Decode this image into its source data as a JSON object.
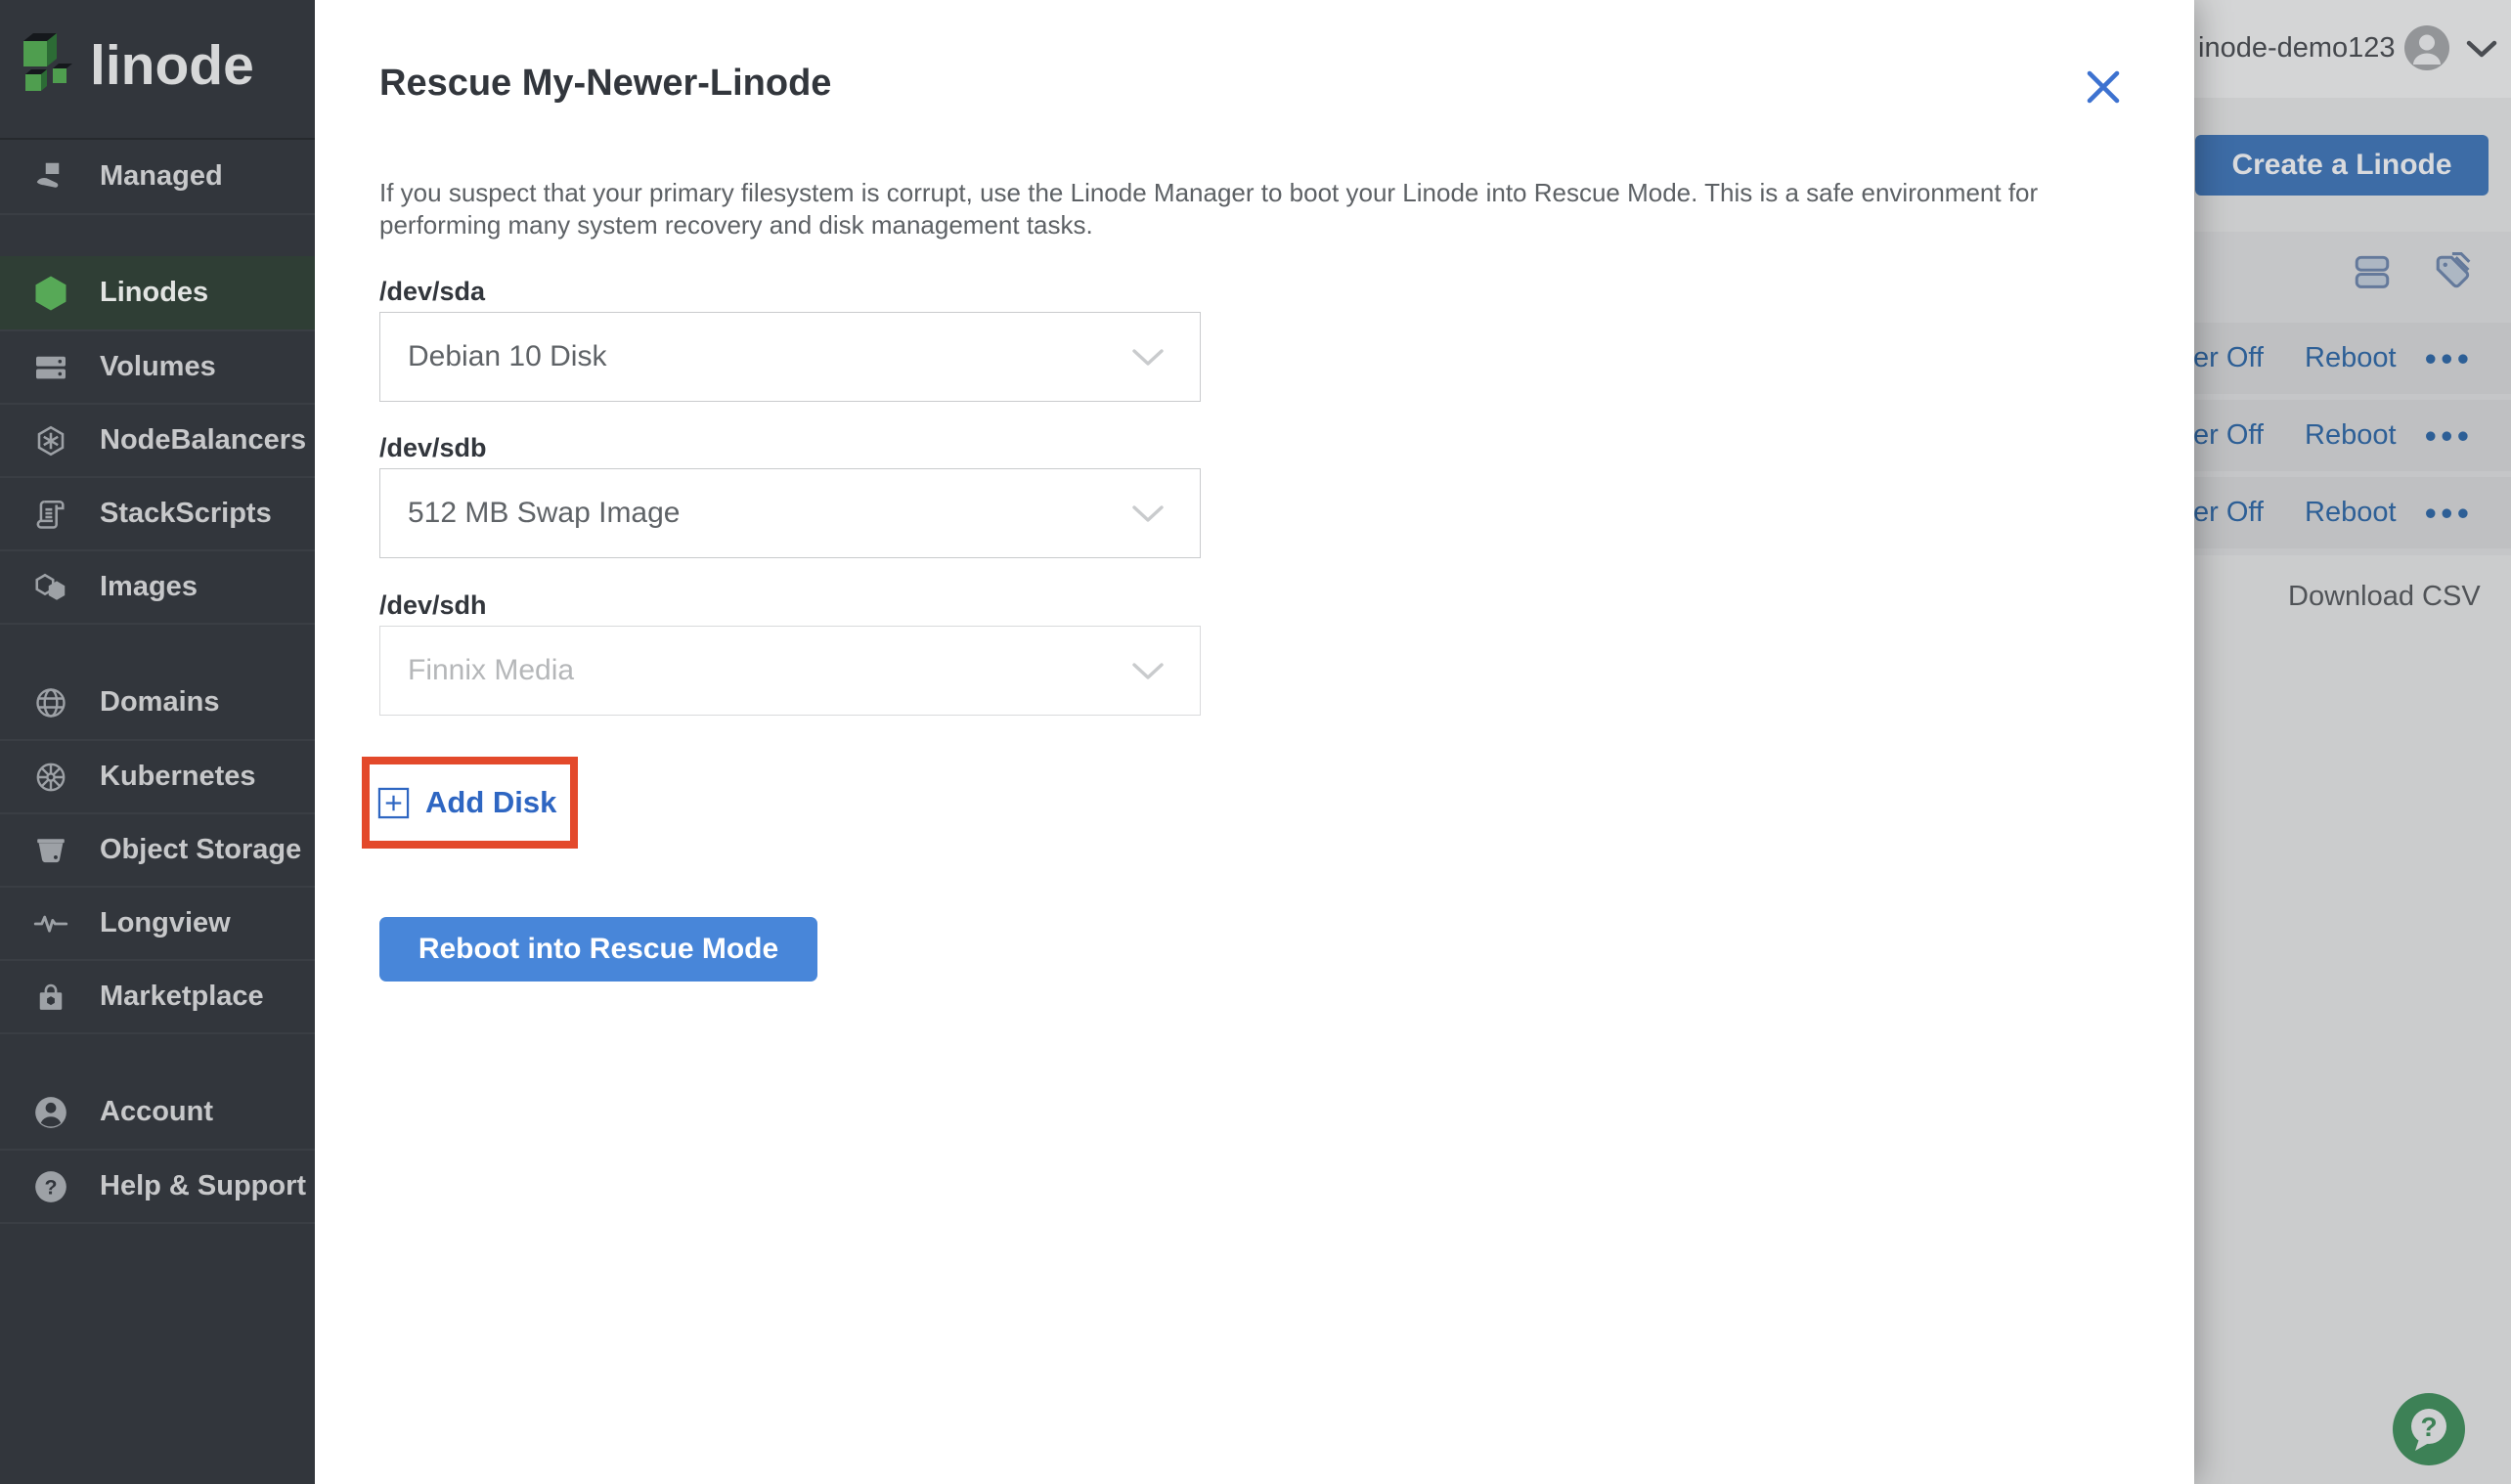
{
  "sidebar": {
    "logo_text": "linode",
    "groups": [
      {
        "items": [
          {
            "label": "Managed"
          }
        ]
      },
      {
        "items": [
          {
            "label": "Linodes",
            "selected": true
          },
          {
            "label": "Volumes"
          },
          {
            "label": "NodeBalancers"
          },
          {
            "label": "StackScripts"
          },
          {
            "label": "Images"
          }
        ]
      },
      {
        "items": [
          {
            "label": "Domains"
          },
          {
            "label": "Kubernetes"
          },
          {
            "label": "Object Storage"
          },
          {
            "label": "Longview"
          },
          {
            "label": "Marketplace"
          }
        ]
      },
      {
        "items": [
          {
            "label": "Account"
          },
          {
            "label": "Help & Support"
          }
        ]
      }
    ]
  },
  "drawer": {
    "title": "Rescue My-Newer-Linode",
    "description": "If you suspect that your primary filesystem is corrupt, use the Linode Manager to boot your Linode into Rescue Mode. This is a safe environment for performing many system recovery and disk management tasks.",
    "fields": [
      {
        "label": "/dev/sda",
        "value": "Debian 10 Disk",
        "disabled": false
      },
      {
        "label": "/dev/sdb",
        "value": "512 MB Swap Image",
        "disabled": false
      },
      {
        "label": "/dev/sdh",
        "value": "Finnix Media",
        "disabled": true
      }
    ],
    "add_disk_label": "Add Disk",
    "submit_label": "Reboot into Rescue Mode"
  },
  "topbar": {
    "username": "inode-demo123"
  },
  "background_page": {
    "create_button_label": "Create a Linode",
    "table_rows": [
      {
        "power_label": "er Off",
        "reboot_label": "Reboot",
        "more_label": "•••"
      },
      {
        "power_label": "er Off",
        "reboot_label": "Reboot",
        "more_label": "•••"
      },
      {
        "power_label": "er Off",
        "reboot_label": "Reboot",
        "more_label": "•••"
      }
    ],
    "download_csv_label": "Download CSV"
  },
  "colors": {
    "accent_blue": "#3683dc",
    "submit_blue": "#4886d9",
    "annotation_red": "#e3492b",
    "sidebar_bg": "#32363c",
    "sidebar_selected_bg": "#2f3e35",
    "linode_green": "#57a957",
    "help_fab_green": "#3d8156"
  }
}
